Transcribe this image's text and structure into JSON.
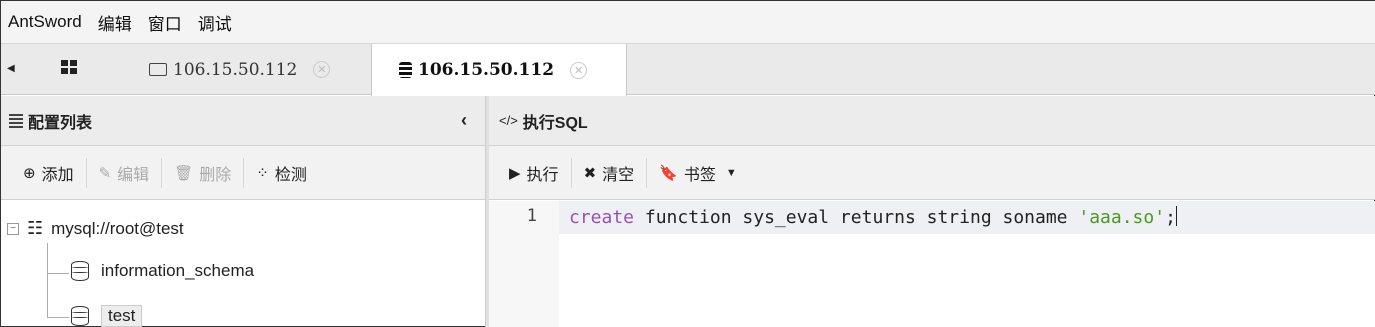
{
  "menu": [
    "AntSword",
    "编辑",
    "窗口",
    "调试"
  ],
  "tabs": [
    {
      "label": "106.15.50.112",
      "icon": "folder-icon",
      "active": false
    },
    {
      "label": "106.15.50.112",
      "icon": "database-icon",
      "active": true
    }
  ],
  "left_panel": {
    "title": "配置列表",
    "toolbar": {
      "add": "添加",
      "edit": "编辑",
      "delete": "删除",
      "check": "检测"
    },
    "tree": {
      "root": "mysql://root@test",
      "children": [
        "information_schema",
        "test"
      ]
    }
  },
  "right_panel": {
    "title": "执行SQL",
    "toolbar": {
      "execute": "执行",
      "clear": "清空",
      "bookmarks": "书签"
    },
    "editor": {
      "line_number": "1",
      "code": {
        "kw": "create",
        "mid": " function sys_eval returns string soname ",
        "str": "'aaa.so'",
        "end": ";"
      }
    }
  },
  "colors": {
    "keyword": "#9b4fb5",
    "string": "#4a9a22"
  }
}
